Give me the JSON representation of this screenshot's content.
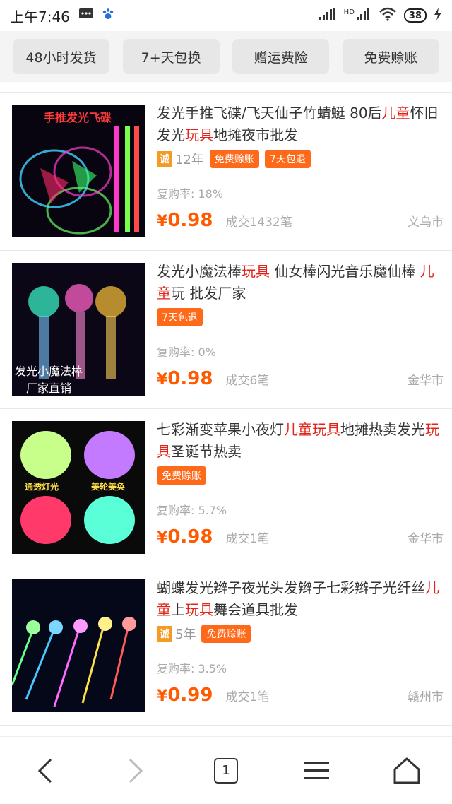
{
  "status": {
    "time": "上午7:46",
    "network": "HD",
    "battery": "38"
  },
  "filters": [
    "48小时发货",
    "7+天包换",
    "赠运费险",
    "免费赊账"
  ],
  "products": [
    {
      "title_parts": [
        {
          "text": "发光手推飞碟/飞天仙子竹蜻蜓 80后",
          "hl": false
        },
        {
          "text": "儿童",
          "hl": true
        },
        {
          "text": "怀旧发光",
          "hl": false
        },
        {
          "text": "玩具",
          "hl": true
        },
        {
          "text": "地摊夜市批发",
          "hl": false
        }
      ],
      "cheng_badge": "诚",
      "years": "12年",
      "tags": [
        "免费赊账",
        "7天包退"
      ],
      "repurchase": "复购率: 18%",
      "price_symbol": "¥",
      "price": "0.98",
      "deals": "成交1432笔",
      "city": "义乌市",
      "image_text": "手推发光飞碟"
    },
    {
      "title_parts": [
        {
          "text": "发光小魔法棒",
          "hl": false
        },
        {
          "text": "玩具",
          "hl": true
        },
        {
          "text": " 仙女棒闪光音乐魔仙棒 ",
          "hl": false
        },
        {
          "text": "儿童",
          "hl": true
        },
        {
          "text": "玩 批发厂家",
          "hl": false
        }
      ],
      "cheng_badge": "",
      "years": "",
      "tags": [
        "7天包退"
      ],
      "repurchase": "复购率: 0%",
      "price_symbol": "¥",
      "price": "0.98",
      "deals": "成交6笔",
      "city": "金华市",
      "image_text": "发光小魔法棒",
      "image_text2": "厂家直销"
    },
    {
      "title_parts": [
        {
          "text": "七彩渐变苹果小夜灯",
          "hl": false
        },
        {
          "text": "儿童玩具",
          "hl": true
        },
        {
          "text": "地摊热卖发光",
          "hl": false
        },
        {
          "text": "玩具",
          "hl": true
        },
        {
          "text": "圣诞节热卖",
          "hl": false
        }
      ],
      "cheng_badge": "",
      "years": "",
      "tags": [
        "免费赊账"
      ],
      "repurchase": "复购率: 5.7%",
      "price_symbol": "¥",
      "price": "0.98",
      "deals": "成交1笔",
      "city": "金华市",
      "image_text": "通透灯光",
      "image_text2": "美轮美奂"
    },
    {
      "title_parts": [
        {
          "text": "蝴蝶发光辫子夜光头发辫子七彩辫子光纤丝",
          "hl": false
        },
        {
          "text": "儿童",
          "hl": true
        },
        {
          "text": "上",
          "hl": false
        },
        {
          "text": "玩具",
          "hl": true
        },
        {
          "text": "舞会道具批发",
          "hl": false
        }
      ],
      "cheng_badge": "诚",
      "years": "5年",
      "tags": [
        "免费赊账"
      ],
      "repurchase": "复购率: 3.5%",
      "price_symbol": "¥",
      "price": "0.99",
      "deals": "成交1笔",
      "city": "赣州市"
    }
  ],
  "nav": {
    "tab_count": "1"
  },
  "colors": {
    "price": "#ff5a00",
    "highlight": "#e2231a",
    "tag_bg": "#ff6a1a",
    "cheng": "#f59a23"
  }
}
